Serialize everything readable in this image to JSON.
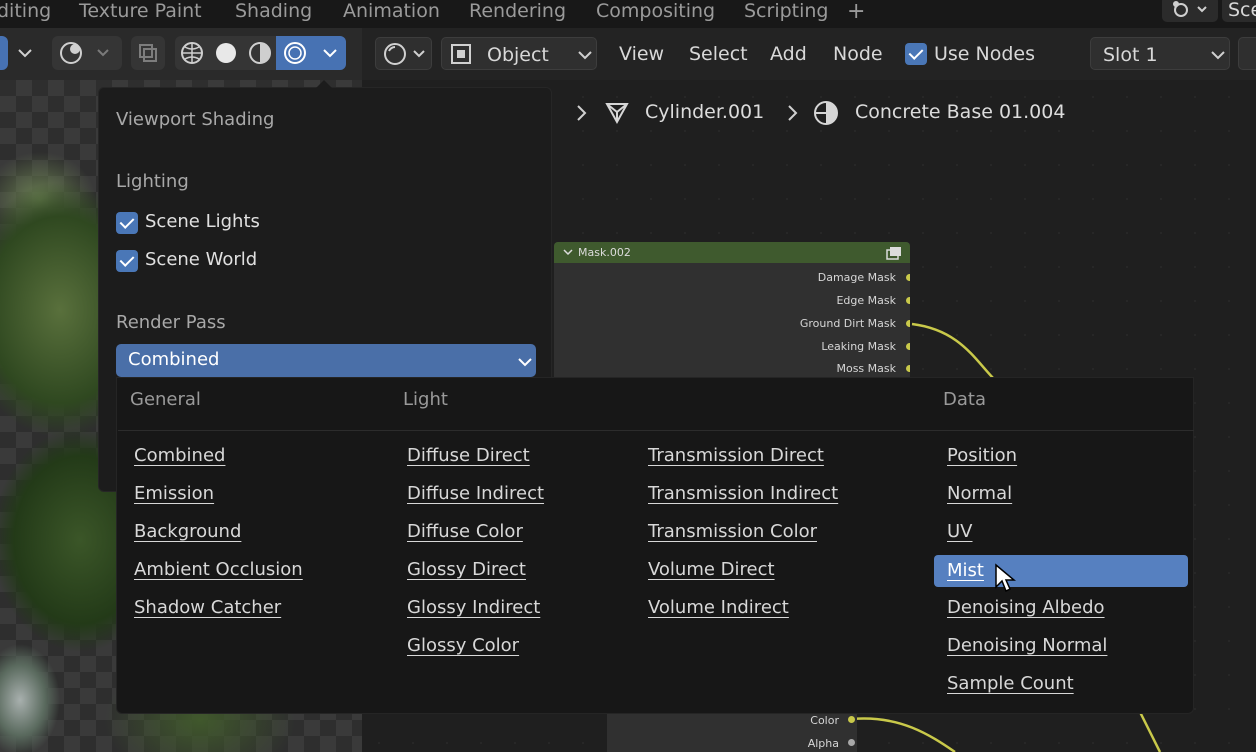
{
  "workspace_tabs": [
    "diting",
    "Texture Paint",
    "Shading",
    "Animation",
    "Rendering",
    "Compositing",
    "Scripting"
  ],
  "scene_label": "Sce",
  "node_header": {
    "mode": "Object",
    "menus": [
      "View",
      "Select",
      "Add",
      "Node"
    ],
    "use_nodes_label": "Use Nodes",
    "slot": "Slot 1"
  },
  "breadcrumb": {
    "object": "Cylinder.001",
    "material": "Concrete Base 01.004"
  },
  "mask_node": {
    "title": "Mask.002",
    "outputs": [
      "Damage Mask",
      "Edge Mask",
      "Ground Dirt Mask",
      "Leaking Mask",
      "Moss Mask"
    ],
    "bottom_outputs": [
      "Color",
      "Alpha"
    ]
  },
  "shading_panel": {
    "title": "Viewport Shading",
    "lighting_label": "Lighting",
    "scene_lights": "Scene Lights",
    "scene_world": "Scene World",
    "render_pass_label": "Render Pass",
    "render_pass_value": "Combined"
  },
  "pass_menu": {
    "headers": {
      "general": "General",
      "light": "Light",
      "data": "Data"
    },
    "general": [
      "Combined",
      "Emission",
      "Background",
      "Ambient Occlusion",
      "Shadow Catcher"
    ],
    "light_diffuse_glossy": [
      "Diffuse Direct",
      "Diffuse Indirect",
      "Diffuse Color",
      "Glossy Direct",
      "Glossy Indirect",
      "Glossy Color"
    ],
    "light_transmission_volume": [
      "Transmission Direct",
      "Transmission Indirect",
      "Transmission Color",
      "Volume Direct",
      "Volume Indirect"
    ],
    "data": [
      "Position",
      "Normal",
      "UV",
      "Mist",
      "Denoising Albedo",
      "Denoising Normal",
      "Sample Count"
    ],
    "selected": "Mist"
  },
  "colors": {
    "accent": "#4772b3",
    "selected_item": "#5680c0",
    "node_header": "#3f5a2e",
    "socket": "#c9c94a"
  }
}
